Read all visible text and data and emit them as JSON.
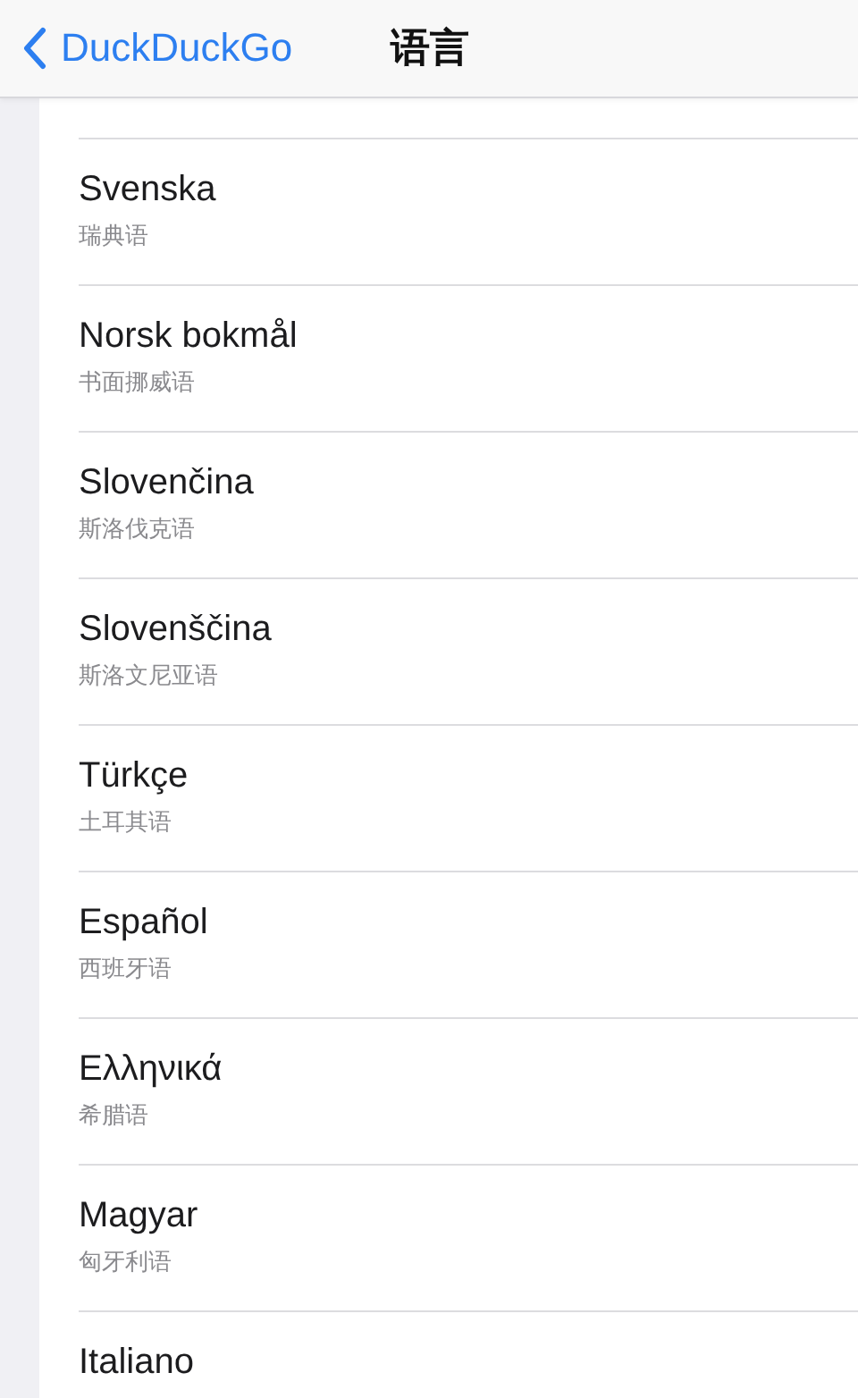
{
  "nav": {
    "back": "DuckDuckGo",
    "title": "语言"
  },
  "languages": [
    {
      "name": "Svenska",
      "translation": "瑞典语"
    },
    {
      "name": "Norsk bokmål",
      "translation": "书面挪威语"
    },
    {
      "name": "Slovenčina",
      "translation": "斯洛伐克语"
    },
    {
      "name": "Slovenščina",
      "translation": "斯洛文尼亚语"
    },
    {
      "name": "Türkçe",
      "translation": "土耳其语"
    },
    {
      "name": "Español",
      "translation": "西班牙语"
    },
    {
      "name": "Ελληνικά",
      "translation": "希腊语"
    },
    {
      "name": "Magyar",
      "translation": "匈牙利语"
    },
    {
      "name": "Italiano"
    }
  ]
}
